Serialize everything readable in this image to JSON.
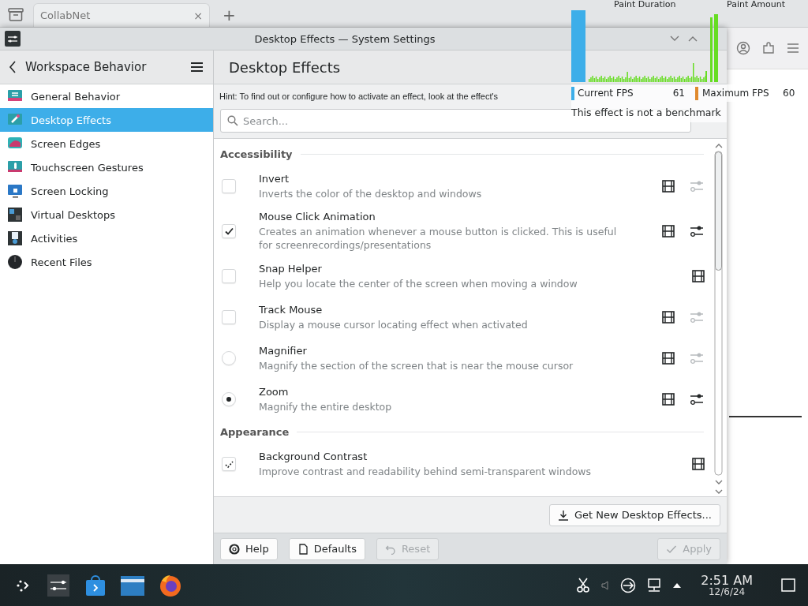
{
  "browser": {
    "tab": {
      "title": "CollabNet",
      "close": "×"
    },
    "new_tab": "+"
  },
  "window": {
    "title": "Desktop Effects — System Settings"
  },
  "sidebar": {
    "title": "Workspace Behavior",
    "items": [
      {
        "label": "General Behavior",
        "selected": false
      },
      {
        "label": "Desktop Effects",
        "selected": true
      },
      {
        "label": "Screen Edges",
        "selected": false
      },
      {
        "label": "Touchscreen Gestures",
        "selected": false
      },
      {
        "label": "Screen Locking",
        "selected": false
      },
      {
        "label": "Virtual Desktops",
        "selected": false
      },
      {
        "label": "Activities",
        "selected": false
      },
      {
        "label": "Recent Files",
        "selected": false
      }
    ]
  },
  "page": {
    "title": "Desktop Effects",
    "hint": "Hint: To find out or configure how to activate an effect, look at the effect's",
    "search": {
      "placeholder": "Search..."
    },
    "sections": [
      {
        "title": "Accessibility",
        "effects": [
          {
            "name": "Invert",
            "description": "Inverts the color of the desktop and windows",
            "kind": "checkbox",
            "checked": false,
            "configurable": true,
            "config_enabled": false
          },
          {
            "name": "Mouse Click Animation",
            "description": "Creates an animation whenever a mouse button is clicked. This is useful for screenrecordings/presentations",
            "kind": "checkbox",
            "checked": true,
            "configurable": true,
            "config_enabled": true
          },
          {
            "name": "Snap Helper",
            "description": "Help you locate the center of the screen when moving a window",
            "kind": "checkbox",
            "checked": false,
            "configurable": false
          },
          {
            "name": "Track Mouse",
            "description": "Display a mouse cursor locating effect when activated",
            "kind": "checkbox",
            "checked": false,
            "configurable": true,
            "config_enabled": false
          },
          {
            "name": "Magnifier",
            "description": "Magnify the section of the screen that is near the mouse cursor",
            "kind": "radio",
            "selected": false,
            "configurable": true,
            "config_enabled": false
          },
          {
            "name": "Zoom",
            "description": "Magnify the entire desktop",
            "kind": "radio",
            "selected": true,
            "configurable": true,
            "config_enabled": true
          }
        ]
      },
      {
        "title": "Appearance",
        "effects": [
          {
            "name": "Background Contrast",
            "description": "Improve contrast and readability behind semi-transparent windows",
            "kind": "default-checkbox",
            "checked": true,
            "configurable": false
          }
        ]
      }
    ],
    "get_new": "Get New Desktop Effects...",
    "buttons": [
      {
        "label": "Help",
        "disabled": false
      },
      {
        "label": "Defaults",
        "disabled": false
      },
      {
        "label": "Reset",
        "disabled": true
      },
      {
        "label": "Apply",
        "disabled": true
      }
    ]
  },
  "fps_overlay": {
    "paint_duration": "Paint Duration",
    "paint_amount": "Paint Amount",
    "current_label": "Current FPS",
    "current_value": "61",
    "max_label": "Maximum FPS",
    "max_value": "60",
    "note": "This effect is not a benchmark"
  },
  "taskbar": {
    "time": "2:51 AM",
    "date": "12/6/24"
  }
}
